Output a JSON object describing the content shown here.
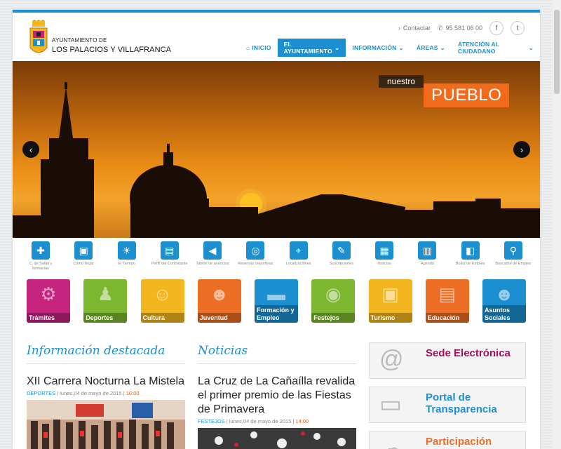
{
  "header": {
    "brand_small": "AYUNTAMIENTO DE",
    "brand_big": "LOS PALACIOS Y VILLAFRANCA",
    "contact_label": "Contactar",
    "phone": "95 581 06 00",
    "facebook_glyph": "f",
    "twitter_glyph": "t"
  },
  "nav": {
    "items": [
      {
        "label": "INICIO",
        "icon": "home-icon"
      },
      {
        "label": "EL AYUNTAMIENTO"
      },
      {
        "label": "INFORMACIÓN"
      },
      {
        "label": "ÁREAS"
      },
      {
        "label": "ATENCIÓN AL CIUDADANO"
      }
    ]
  },
  "hero": {
    "tag_small": "nuestro",
    "tag_big": "PUEBLO",
    "prev": "‹",
    "next": "›"
  },
  "quick_links": [
    {
      "label": "C. de Salud y farmacias",
      "glyph": "✚"
    },
    {
      "label": "Cómo llegar",
      "glyph": "▣"
    },
    {
      "label": "El Tiempo",
      "glyph": "☀"
    },
    {
      "label": "Perfil del Contratante",
      "glyph": "▤"
    },
    {
      "label": "Tablón de anuncios",
      "glyph": "◀"
    },
    {
      "label": "Reservas deportivas",
      "glyph": "◎"
    },
    {
      "label": "Localizaciones",
      "glyph": "⌖"
    },
    {
      "label": "Suscripciones",
      "glyph": "✎"
    },
    {
      "label": "Noticias",
      "glyph": "▦"
    },
    {
      "label": "Agenda",
      "glyph": "▥"
    },
    {
      "label": "Bolsa de Empleo",
      "glyph": "◧"
    },
    {
      "label": "Buscador de Empleo",
      "glyph": "⚲"
    }
  ],
  "tiles": [
    {
      "label": "Trámites",
      "color": "#c4237e",
      "glyph": "⚙"
    },
    {
      "label": "Deportes",
      "color": "#7db72f",
      "glyph": "♟"
    },
    {
      "label": "Cultura",
      "color": "#f3b61f",
      "glyph": "☺"
    },
    {
      "label": "Juventud",
      "color": "#ec6e24",
      "glyph": "☻"
    },
    {
      "label": "Formación y Empleo",
      "color": "#1b8fd0",
      "glyph": "▬"
    },
    {
      "label": "Festejos",
      "color": "#7db72f",
      "glyph": "◉"
    },
    {
      "label": "Turismo",
      "color": "#f3b61f",
      "glyph": "▣"
    },
    {
      "label": "Educación",
      "color": "#ec6e24",
      "glyph": "▤"
    },
    {
      "label": "Asuntos Sociales",
      "color": "#1b8fd0",
      "glyph": "☻"
    }
  ],
  "featured": {
    "heading": "Información destacada",
    "title": "XII Carrera Nocturna La Mistela",
    "category": "DEPORTES",
    "date": " | lunes,04 de mayo de 2015 | ",
    "time": "10:00"
  },
  "news": {
    "heading": "Noticias",
    "title": "La Cruz de La Cañaílla revalida el primer premio de las Fiestas de Primavera",
    "category": "FESTEJOS",
    "date": " | lunes,04 de mayo de 2015 | ",
    "time": "14:00"
  },
  "side": [
    {
      "title": "Sede Electrónica",
      "color": "#a3115e",
      "glyph": "@"
    },
    {
      "title": "Portal de Transparencia",
      "color": "#1b8fd0",
      "glyph": "▭"
    },
    {
      "title": "Participación",
      "color": "#ec6e24",
      "glyph": "☁"
    }
  ]
}
